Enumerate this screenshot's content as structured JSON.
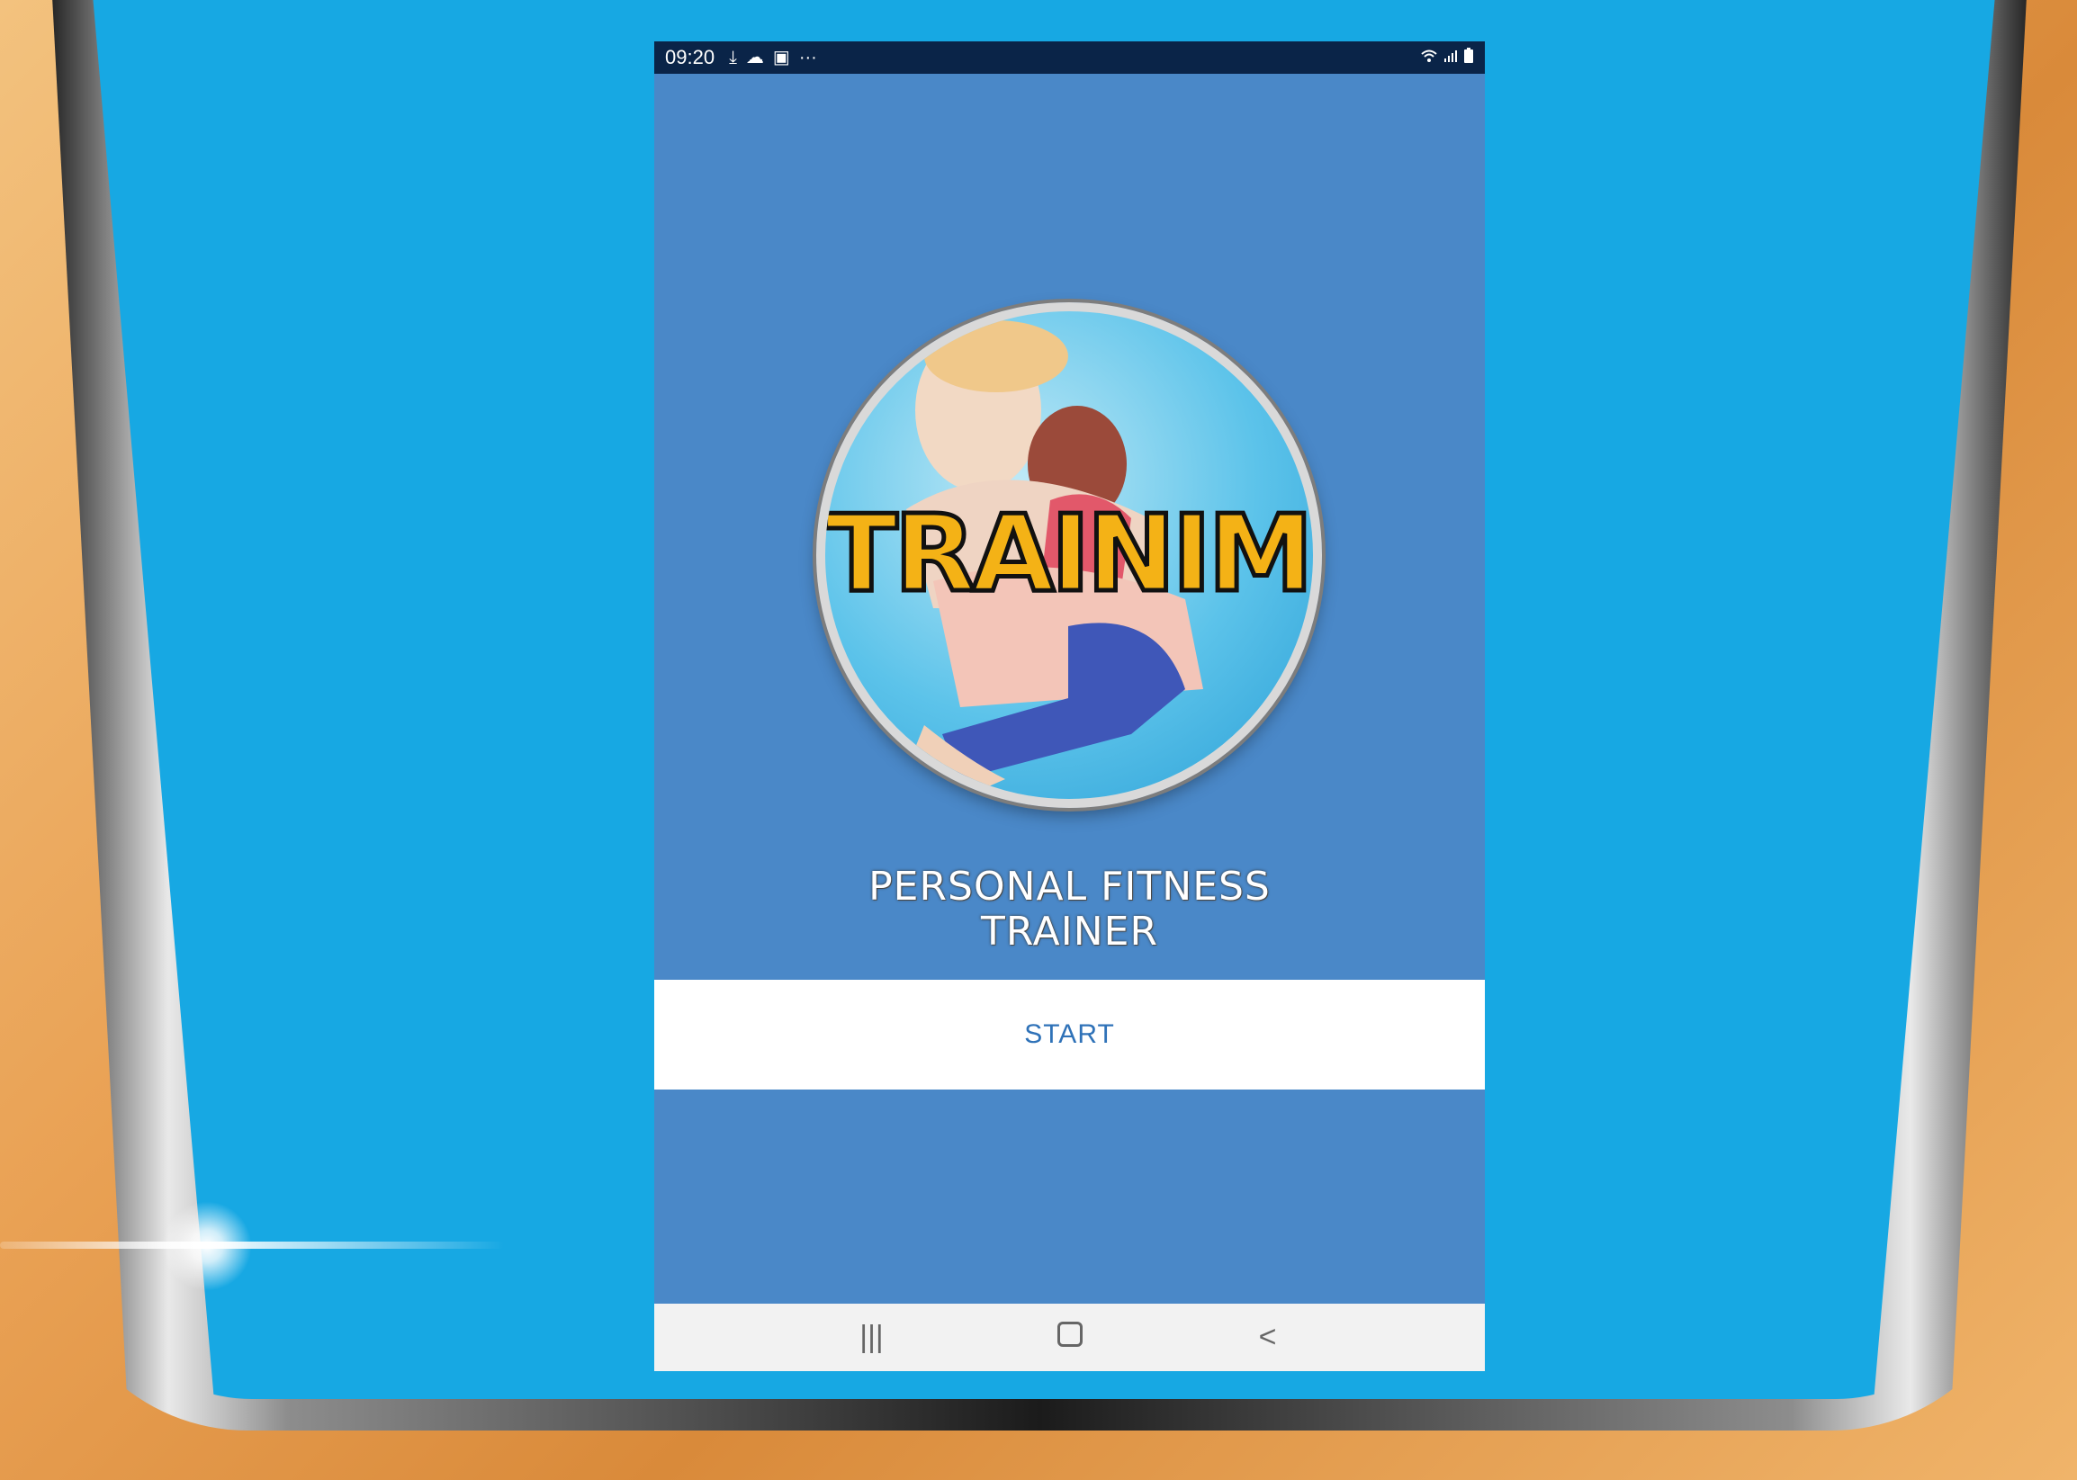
{
  "status_bar": {
    "time": "09:20",
    "left_icons": [
      "download-icon",
      "weather-icon",
      "gallery-icon",
      "more-icon"
    ],
    "more_glyph": "···",
    "right_icons": [
      "wifi-icon",
      "signal-icon",
      "battery-icon"
    ]
  },
  "logo": {
    "text": "TRAINIME"
  },
  "app_title": {
    "line1": "PERSONAL FITNESS",
    "line2": "TRAINER"
  },
  "start_button": {
    "label": "START"
  },
  "nav_bar": {
    "recents_glyph": "|||",
    "back_glyph": "<"
  },
  "colors": {
    "app_background": "#4a88c8",
    "status_bar": "#0a2448",
    "button_text": "#2f72b8",
    "logo_text": "#f4b216",
    "outer_screen": "#17a8e3"
  }
}
